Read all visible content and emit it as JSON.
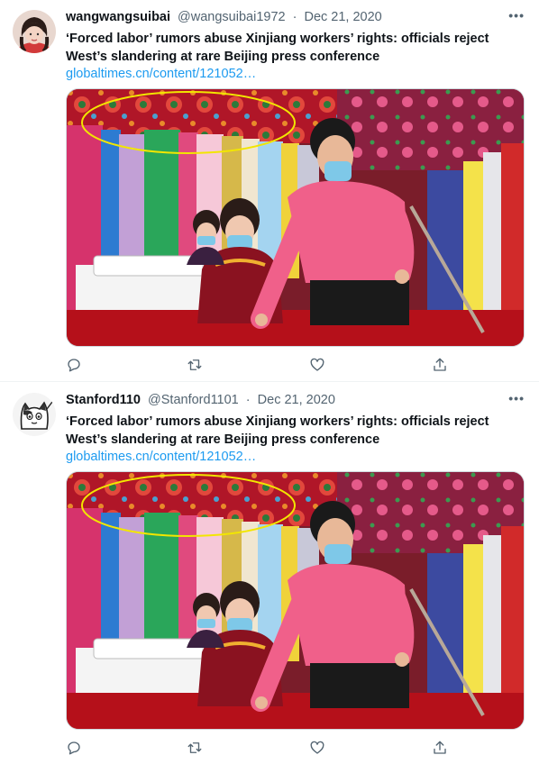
{
  "tweets": [
    {
      "display_name": "wangwangsuibai",
      "handle": "@wangsuibai1972",
      "separator": "·",
      "date": "Dec 21, 2020",
      "text_line1": "‘Forced labor’ rumors abuse Xinjiang workers’ rights: officials reject",
      "text_line2": "West’s slandering at rare Beijing press conference",
      "link": "globaltimes.cn/content/121052…",
      "more": "•••",
      "avatar_icon": "profile-photo-woman",
      "actions": [
        "reply-icon",
        "retweet-icon",
        "like-icon",
        "share-icon"
      ]
    },
    {
      "display_name": "Stanford110",
      "handle": "@Stanford1101",
      "separator": "·",
      "date": "Dec 21, 2020",
      "text_line1": "‘Forced labor’ rumors abuse Xinjiang workers’ rights: officials reject",
      "text_line2": "West’s slandering at rare Beijing press conference",
      "link": "globaltimes.cn/content/121052…",
      "more": "•••",
      "avatar_icon": "cartoon-cat-avatar",
      "actions": [
        "reply-icon",
        "retweet-icon",
        "like-icon",
        "share-icon"
      ]
    }
  ],
  "colors": {
    "link": "#1d9bf0",
    "secondary_text": "#536471",
    "highlight_annotation": "#f2e600",
    "shirt_pink": "#f0608a",
    "tablecloth_red": "#c0101a"
  }
}
